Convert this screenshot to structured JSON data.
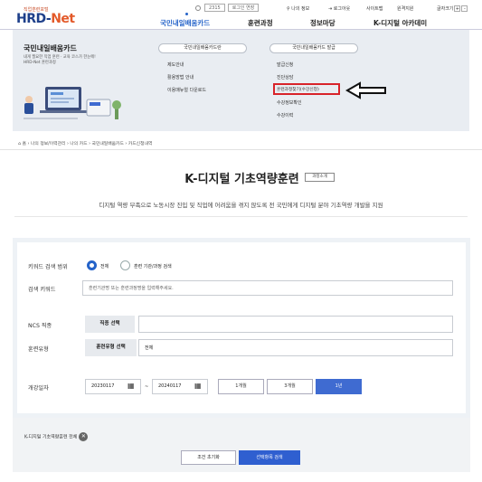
{
  "header": {
    "logo_sub": "직업훈련포털",
    "logo_main": "HRD-",
    "logo_net": "Net",
    "session_time": "2315",
    "extend_label": "로그인 연장",
    "util": [
      "나의 정보",
      "로그아웃",
      "사이트맵",
      "원격지원",
      "글자크기"
    ],
    "font_controls": [
      "+",
      "-"
    ]
  },
  "gnb": {
    "items": [
      "국민내일배움카드",
      "훈련과정",
      "정보마당",
      "K-디지털 아카데미"
    ]
  },
  "hero": {
    "title": "국민내일배움카드",
    "desc": "내게 필요한 직업 훈련 · 교육 코스가 한눈에! HRD-Net 훈련과정",
    "col1_head": "국민내일배움카드란",
    "col1_items": [
      "제도안내",
      "활용방법 안내",
      "이용매뉴얼 다운로드"
    ],
    "col2_head": "국민내일배움카드 발급",
    "col2_items": [
      "발급신청",
      "진단상담",
      "훈련과정찾기(수강신청)",
      "수강정보확인",
      "수강이력"
    ]
  },
  "breadcrumb": [
    "홈",
    "나의 정보/이력관리",
    "나의 카드",
    "국민내일배움카드",
    "카드신청내역"
  ],
  "page": {
    "title": "K-디지털 기초역량훈련",
    "badge": "과정소개",
    "desc": "디지털 역량 부족으로 노동시장 진입 및 직업에 어려움을 겪지 않도록 전 국민에게 디지털 분야 기초역량 개발을 지원"
  },
  "form": {
    "scope_label": "키워드 검색 범위",
    "scope_options": [
      "전체",
      "훈련 기관/과정 검색"
    ],
    "keyword_label": "검색 키워드",
    "keyword_placeholder": "훈련기관명 또는 훈련과정명을 입력해주세요.",
    "ncs_label": "NCS 직종",
    "ncs_button": "직종 선택",
    "type_label": "훈련유형",
    "type_button": "훈련유형 선택",
    "type_value": "전체",
    "date_label": "개강일자",
    "date_from": "20230117",
    "date_sep": "~",
    "date_to": "20240117",
    "periods": [
      "1개월",
      "3개월",
      "1년"
    ]
  },
  "bottom": {
    "chip": "K-디지털 기초역량훈련 전체",
    "reset": "조건 초기화",
    "search": "선택항목 검색"
  },
  "colors": {
    "accent": "#2563c9",
    "callout": "#d8232a",
    "brand": "#1e3f8a"
  }
}
